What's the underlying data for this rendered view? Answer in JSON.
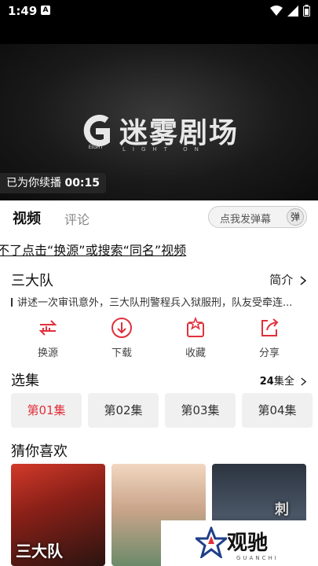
{
  "status_bar": {
    "time": "1:49",
    "badge": "A"
  },
  "player": {
    "logo_title": "迷雾剧场",
    "logo_sub": "LIGHT ON",
    "logo_badge": "EIGHT",
    "resume_text": "已为你续播",
    "resume_time": "00:15"
  },
  "tabs": {
    "video": "视频",
    "comment": "评论"
  },
  "danmu": {
    "placeholder": "点我发弹幕",
    "button": "弹"
  },
  "notice": "不了点击“换源”或搜索“同名”视频",
  "show": {
    "title": "三大队",
    "intro_label": "简介",
    "description": "讲述一次审讯意外，三大队刑警程兵入狱服刑，队友受牵连..."
  },
  "actions": [
    {
      "label": "换源",
      "icon": "switch-source-icon"
    },
    {
      "label": "下载",
      "icon": "download-icon"
    },
    {
      "label": "收藏",
      "icon": "favorite-icon"
    },
    {
      "label": "分享",
      "icon": "share-icon"
    }
  ],
  "episodes": {
    "heading": "选集",
    "count": "24",
    "count_suffix": "集全",
    "items": [
      "第01集",
      "第02集",
      "第03集",
      "第04集"
    ]
  },
  "recommend": {
    "heading": "猜你喜欢",
    "poster1_caption": "三大队",
    "poster3_caption": "刺"
  },
  "watermark": {
    "title": "观驰",
    "sub": "GUANCHI"
  },
  "colors": {
    "accent": "#e0303b",
    "player_bg": "#0b0b0b"
  }
}
